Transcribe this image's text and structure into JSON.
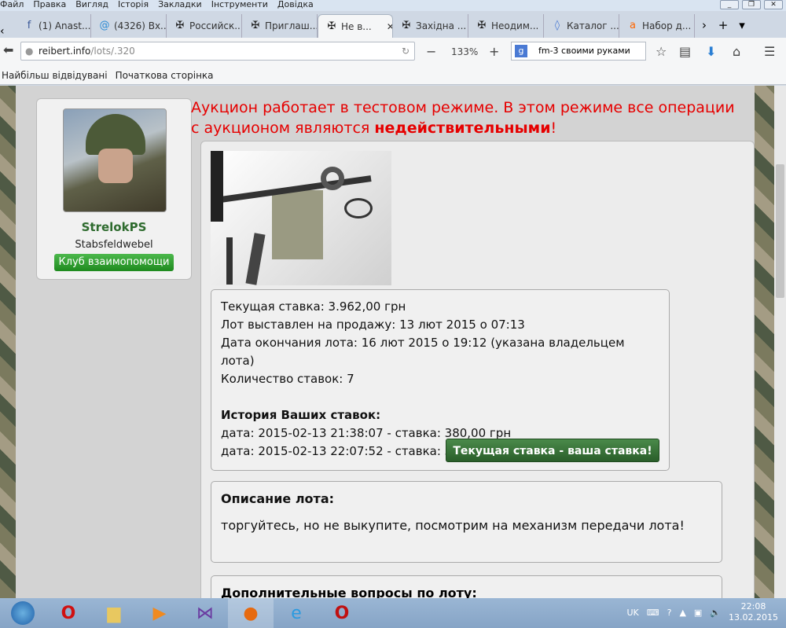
{
  "menu": [
    "Файл",
    "Правка",
    "Вигляд",
    "Історія",
    "Закладки",
    "Інструменти",
    "Довідка"
  ],
  "tabs": [
    {
      "label": "(1) Anast...",
      "icon": "facebook-icon",
      "glyph": "f",
      "color": "#3b5998"
    },
    {
      "label": "(4326) Вх...",
      "icon": "mail-icon",
      "glyph": "@",
      "color": "#2a8ad4"
    },
    {
      "label": "Российск...",
      "icon": "cross-icon",
      "glyph": "✠",
      "color": "#222"
    },
    {
      "label": "Приглаш...",
      "icon": "cross-icon",
      "glyph": "✠",
      "color": "#222"
    },
    {
      "label": "Не в...",
      "icon": "cross-icon",
      "glyph": "✠",
      "color": "#222",
      "active": true
    },
    {
      "label": "Західна ...",
      "icon": "cross-icon",
      "glyph": "✠",
      "color": "#222"
    },
    {
      "label": "Неодим...",
      "icon": "cross-icon",
      "glyph": "✠",
      "color": "#222"
    },
    {
      "label": "Каталог ...",
      "icon": "diamond-icon",
      "glyph": "◊",
      "color": "#4a7ad4"
    },
    {
      "label": "Набор д...",
      "icon": "amazon-icon",
      "glyph": "a",
      "color": "#f60"
    }
  ],
  "nav": {
    "url_host": "reibert.info",
    "url_path": "/lots/.320",
    "zoom": "133%",
    "search": "fm-3 своими руками"
  },
  "bookmarks": [
    "Найбільш відвідувані",
    "Початкова сторінка"
  ],
  "user": {
    "name": "StrelokPS",
    "rank": "Stabsfeldwebel",
    "club": "Клуб взаимопомощи"
  },
  "warning": {
    "text": "Аукцион работает в тестовом режиме. В этом режиме все операции с аукционом являются ",
    "bold": "недействительными",
    "end": "!"
  },
  "lot": {
    "lines": [
      "Текущая ставка: 3.962,00 грн",
      "Лот выставлен на продажу: 13 лют 2015 о 07:13",
      "Дата окончания лота: 16 лют 2015 о 19:12 (указана владельцем лота)",
      "Количество ставок: 7"
    ],
    "history_title": "История Ваших ставок:",
    "history": [
      "дата: 2015-02-13 21:38:07 - ставка: 380,00 грн",
      "дата: 2015-02-13 22:07:52 - ставка: 3.962,00 грн"
    ],
    "bid_button": "Текущая ставка - ваша ставка!",
    "desc_title": "Описание лота:",
    "desc": "торгуйтесь, но не выкупите, посмотрим на механизм передачи лота!",
    "questions_title": "Дополнительные вопросы по лоту:"
  },
  "tray": {
    "lang": "UK",
    "time": "22:08",
    "date": "13.02.2015"
  }
}
